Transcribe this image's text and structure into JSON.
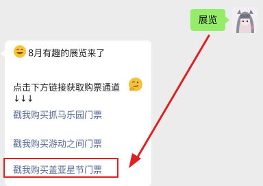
{
  "outgoing": {
    "text": "展览"
  },
  "incoming": {
    "title": "8月有趣的展览来了",
    "instruction": "点击下方链接获取购票通道",
    "arrows": "↓↓↓",
    "links": [
      {
        "label": "戳我购买抓马乐园门票"
      },
      {
        "label": "戳我购买游动之间门票"
      },
      {
        "label": "戳我购买盖亚星节门票"
      }
    ]
  },
  "colors": {
    "outgoing_bubble": "#95ec69",
    "link": "#576b95",
    "highlight": "#e02020",
    "background": "#ececec"
  },
  "icons": [
    "smile-emoji-icon",
    "thinking-emoji-icon",
    "user-avatar"
  ]
}
